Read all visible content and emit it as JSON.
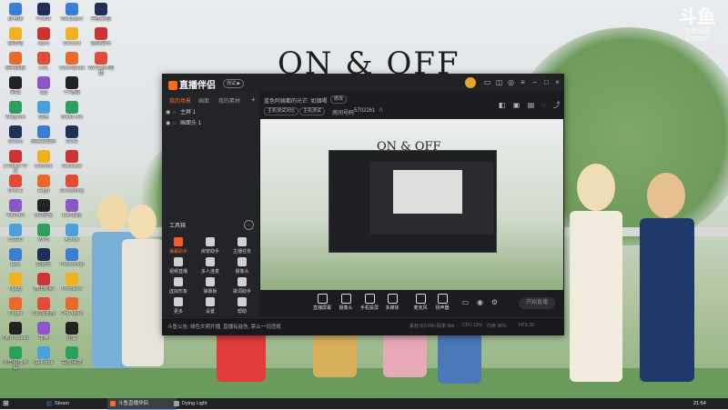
{
  "watermark": {
    "logo": "斗鱼",
    "sub1": "斗鱼直播",
    "sub2": "5702261"
  },
  "wallpaper": {
    "title": "ON & OFF"
  },
  "desktop_icons": [
    "此电脑",
    "回收站",
    "控制面板",
    "网络",
    "Wegame",
    "Steam",
    "2 Relief 中文",
    "Dota 2",
    "Valorant",
    "CSGO",
    "Epic",
    "Uplay",
    "Origin",
    "OBS Studio",
    "斗鱼直播伴侣",
    "PUBG",
    "Apex",
    "LOL",
    "QQ",
    "微信",
    "网易云音乐",
    "Chrome",
    "Edge",
    "360安全",
    "WPS",
    "爱奇艺",
    "腾讯视频",
    "UU加速器",
    "雷神",
    "GeForce",
    "Wallpaper",
    "Discord",
    "TeamSpeak",
    "YY语音",
    "Battle.net",
    "GOG",
    "Rockstar",
    "Everything",
    "Bandizip",
    "Adobe",
    "Photoshop",
    "Premiere",
    "PotPlayer",
    "迅雷",
    "百度网盘",
    "阿里云盘",
    "酷狗音乐",
    "WeGame直播"
  ],
  "app": {
    "title": "直播伴侣",
    "version_badge": "测试 ▶",
    "left_tabs": [
      "我的场景",
      "画面",
      "我的素材"
    ],
    "scenes": [
      "主屏 1",
      "画面头 1"
    ],
    "tools_header": "工具箱",
    "tools_more": "…",
    "tools": [
      {
        "label": "弹幕助手",
        "highlight": true
      },
      {
        "label": "房管助手",
        "highlight": false
      },
      {
        "label": "主播任务",
        "highlight": false
      },
      {
        "label": "视频直播",
        "highlight": false
      },
      {
        "label": "多人连麦",
        "highlight": false
      },
      {
        "label": "摄像头",
        "highlight": false
      },
      {
        "label": "虚拟形象",
        "highlight": false
      },
      {
        "label": "弹幕板",
        "highlight": false
      },
      {
        "label": "歌词助手",
        "highlight": false
      },
      {
        "label": "更多",
        "highlight": false
      },
      {
        "label": "设置",
        "highlight": false
      },
      {
        "label": "帮助",
        "highlight": false
      }
    ],
    "preview_head": {
      "room_title": "蓝色阿姨都的光芒: 如烟喝",
      "badge1": "修改",
      "tag1": "主机测试对比",
      "tag2": "主机测试",
      "room_label": "房间号码",
      "room_number": "5702261",
      "heat": "0"
    },
    "preview": {
      "title": "ON & OFF"
    },
    "bottom_buttons": [
      "直播屏幕",
      "摄像头",
      "手机投屏",
      "多媒体",
      "麦克风",
      "扬声器"
    ],
    "go_live": "开始直播",
    "notice": "斗鱼公告: 绿色文明开播, 直播有益伤, 禁止一切违规",
    "stats": [
      "丢帧 0(0.0%)",
      "码率 0kb",
      "CPU 12%",
      "内存 36%",
      "FPS 30"
    ]
  },
  "taskbar": {
    "tasks": [
      {
        "label": "Steam",
        "active": false,
        "color": "#2a475e"
      },
      {
        "label": "斗鱼直播伴侣",
        "active": true,
        "color": "#ff6a1a"
      },
      {
        "label": "Dying Light",
        "active": false,
        "color": "#9aa1a6"
      }
    ],
    "clock": "21:54"
  }
}
